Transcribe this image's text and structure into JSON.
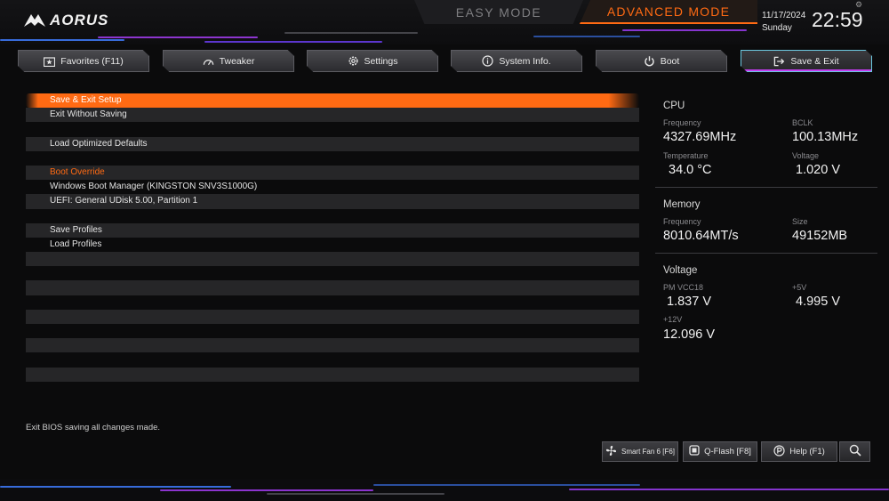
{
  "header": {
    "brand": "AORUS",
    "easy_mode": "EASY MODE",
    "advanced_mode": "ADVANCED MODE",
    "date": "11/17/2024",
    "weekday": "Sunday",
    "time": "22:59"
  },
  "tabs": [
    {
      "label": "Favorites (F11)",
      "icon": "favorites-icon"
    },
    {
      "label": "Tweaker",
      "icon": "speedometer-icon"
    },
    {
      "label": "Settings",
      "icon": "gear-icon"
    },
    {
      "label": "System Info.",
      "icon": "info-icon"
    },
    {
      "label": "Boot",
      "icon": "power-icon"
    },
    {
      "label": "Save & Exit",
      "icon": "exit-icon",
      "active": true
    }
  ],
  "menu": {
    "items": [
      "Save & Exit Setup",
      "Exit Without Saving",
      "",
      "Load Optimized Defaults",
      "",
      "Boot Override",
      "Windows Boot Manager (KINGSTON SNV3S1000G)",
      "UEFI: General UDisk 5.00, Partition 1",
      "",
      "Save Profiles",
      "Load Profiles",
      "",
      "",
      "",
      "",
      "",
      "",
      "",
      "",
      "",
      ""
    ],
    "selected_index": 0,
    "section_index": 5
  },
  "cpu": {
    "title": "CPU",
    "frequency_label": "Frequency",
    "frequency": "4327.69MHz",
    "bclk_label": "BCLK",
    "bclk": "100.13MHz",
    "temperature_label": "Temperature",
    "temperature": "34.0 °C",
    "voltage_label": "Voltage",
    "voltage": "1.020 V"
  },
  "memory": {
    "title": "Memory",
    "frequency_label": "Frequency",
    "frequency": "8010.64MT/s",
    "size_label": "Size",
    "size": "49152MB"
  },
  "voltage": {
    "title": "Voltage",
    "pm_vcc18_label": "PM VCC18",
    "pm_vcc18": "1.837 V",
    "p5v_label": "+5V",
    "p5v": "4.995 V",
    "p12v_label": "+12V",
    "p12v": "12.096 V"
  },
  "footer": {
    "help_text": "Exit BIOS saving all changes made.",
    "smart_fan": "Smart Fan 6 [F6]",
    "qflash": "Q-Flash [F8]",
    "help": "Help (F1)"
  },
  "colors": {
    "accent": "#ff6a13",
    "active_tab_border": "#6cc8e0",
    "active_tab_glow": "#c53df0",
    "row_stripe": "#262628"
  }
}
